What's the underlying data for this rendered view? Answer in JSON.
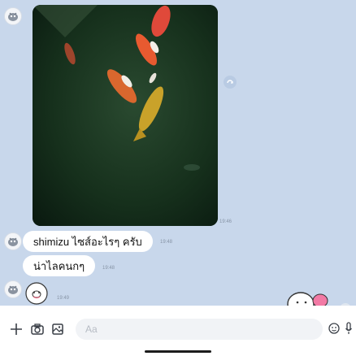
{
  "colors": {
    "chat_background": "#c8d7eb",
    "bubble": "#ffffff",
    "timestamp": "#8794a6",
    "composer_background": "#ffffff",
    "input_background": "#f1f3f6"
  },
  "messages": [
    {
      "type": "image",
      "sender": "contact",
      "content": "koi-fish-pond-photo",
      "time": "19:46"
    },
    {
      "type": "text",
      "sender": "contact",
      "text": "shimizu ไซส์อะไรๆ ครับ",
      "time": "19:48"
    },
    {
      "type": "text",
      "sender": "contact",
      "text": "น่าไลคนกๆ",
      "time": "19:48"
    },
    {
      "type": "sticker",
      "sender": "contact",
      "content": "cartoon-character-sticker",
      "time": "19:49"
    },
    {
      "type": "sticker",
      "sender": "me",
      "content": "animal-sticker-partial"
    }
  ],
  "composer": {
    "placeholder": "Aa",
    "icons": [
      "plus-icon",
      "camera-icon",
      "gallery-icon",
      "emoji-icon",
      "microphone-icon"
    ]
  }
}
